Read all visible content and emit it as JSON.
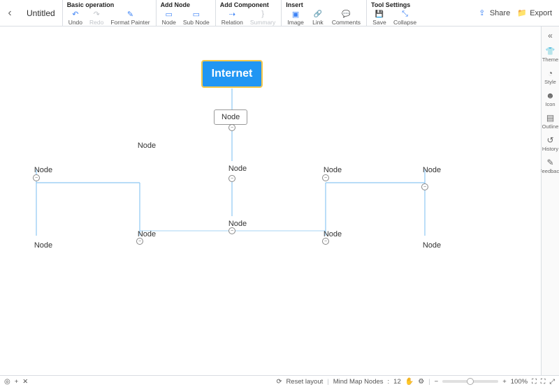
{
  "document": {
    "title": "Untitled"
  },
  "toolbar_groups": {
    "basic": {
      "title": "Basic operation",
      "undo": "Undo",
      "redo": "Redo",
      "format_painter": "Format Painter"
    },
    "add_node": {
      "title": "Add Node",
      "node": "Node",
      "sub_node": "Sub Node"
    },
    "add_component": {
      "title": "Add Component",
      "relation": "Relation",
      "summary": "Summary"
    },
    "insert": {
      "title": "Insert",
      "image": "Image",
      "link": "Link",
      "comments": "Comments"
    },
    "tool_settings": {
      "title": "Tool Settings",
      "save": "Save",
      "collapse": "Collapse"
    }
  },
  "top_right": {
    "share": "Share",
    "export": "Export"
  },
  "right_panel": {
    "theme": "Theme",
    "style": "Style",
    "icon": "Icon",
    "outline": "Outline",
    "history": "History",
    "feedback": "Feedback"
  },
  "root": {
    "label": "Internet"
  },
  "nodes": {
    "c1": "Node",
    "c2": "Node",
    "c3": "Node",
    "l1": "Node",
    "l2": "Node",
    "l3": "Node",
    "l4": "Node",
    "r1": "Node",
    "r2": "Node",
    "r3": "Node",
    "r4": "Node"
  },
  "status": {
    "reset_layout": "Reset layout",
    "nodes_label": "Mind Map Nodes",
    "nodes_count": "12",
    "zoom_percent": "100%"
  },
  "chart_data": {
    "type": "other",
    "subtype": "mind-map",
    "title": "Internet",
    "root": {
      "label": "Internet",
      "children": [
        {
          "label": "Node",
          "children": [
            {
              "label": "Node",
              "children": [
                {
                  "label": "Node",
                  "children": [
                    {
                      "label": "Node",
                      "children": [
                        {
                          "label": "Node"
                        }
                      ]
                    },
                    {
                      "label": "Node",
                      "children": [
                        {
                          "label": "Node"
                        }
                      ]
                    },
                    {
                      "label": "Node",
                      "children": [
                        {
                          "label": "Node"
                        }
                      ]
                    },
                    {
                      "label": "Node",
                      "children": [
                        {
                          "label": "Node"
                        }
                      ]
                    }
                  ]
                }
              ]
            }
          ]
        }
      ]
    },
    "node_count": 12
  }
}
